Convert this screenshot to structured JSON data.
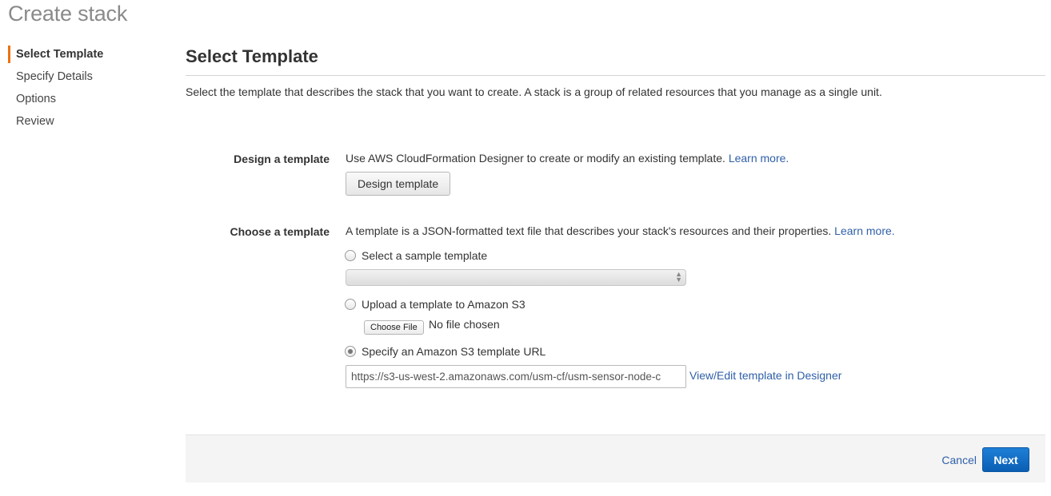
{
  "page": {
    "title": "Create stack"
  },
  "sidebar": {
    "items": [
      {
        "label": "Select Template"
      },
      {
        "label": "Specify Details"
      },
      {
        "label": "Options"
      },
      {
        "label": "Review"
      }
    ]
  },
  "main": {
    "section_title": "Select Template",
    "intro": "Select the template that describes the stack that you want to create. A stack is a group of related resources that you manage as a single unit.",
    "design": {
      "label": "Design a template",
      "description": "Use AWS CloudFormation Designer to create or modify an existing template.",
      "learn_more": "Learn more.",
      "button": "Design template"
    },
    "choose": {
      "label": "Choose a template",
      "description": "A template is a JSON-formatted text file that describes your stack's resources and their properties.",
      "learn_more": "Learn more.",
      "options": {
        "sample": "Select a sample template",
        "upload": "Upload a template to Amazon S3",
        "url": "Specify an Amazon S3 template URL"
      },
      "selected_option": "url",
      "file_button": "Choose File",
      "file_status": "No file chosen",
      "url_value": "https://s3-us-west-2.amazonaws.com/usm-cf/usm-sensor-node-c",
      "designer_link": "View/Edit template in Designer"
    }
  },
  "footer": {
    "cancel": "Cancel",
    "next": "Next"
  }
}
